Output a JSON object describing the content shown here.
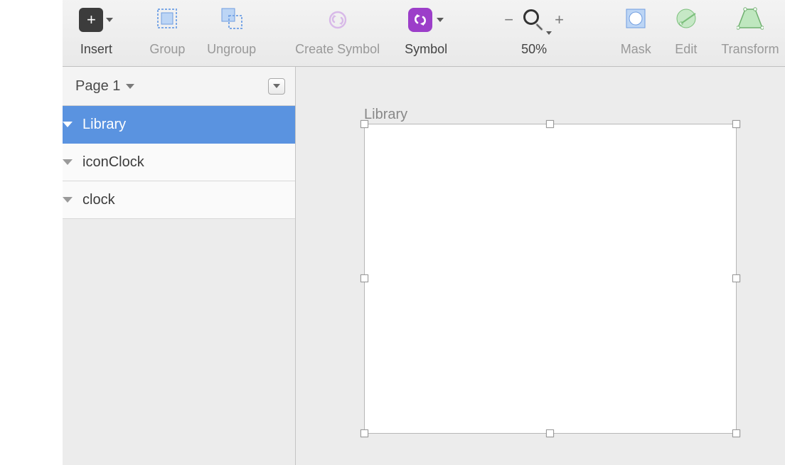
{
  "toolbar": {
    "insert_label": "Insert",
    "group_label": "Group",
    "ungroup_label": "Ungroup",
    "create_symbol_label": "Create Symbol",
    "symbol_label": "Symbol",
    "zoom_label": "50%",
    "mask_label": "Mask",
    "edit_label": "Edit",
    "transform_label": "Transform"
  },
  "pages": {
    "current": "Page 1"
  },
  "layers": [
    {
      "name": "Library",
      "depth": 0,
      "selected": true
    },
    {
      "name": "iconClock",
      "depth": 1,
      "selected": false
    },
    {
      "name": "clock",
      "depth": 1,
      "selected": false
    }
  ],
  "canvas": {
    "artboard_label": "Library"
  },
  "colors": {
    "selection": "#5a93e0",
    "symbol": "#9c3ec9"
  }
}
